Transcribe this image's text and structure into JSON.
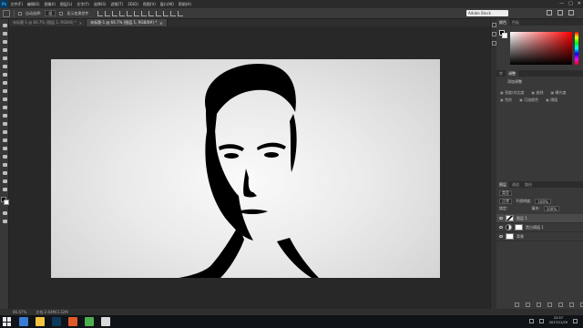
{
  "menubar": {
    "logo": "Ps",
    "items": [
      "文件(F)",
      "编辑(E)",
      "图像(I)",
      "图层(L)",
      "文字(Y)",
      "选择(S)",
      "滤镜(T)",
      "3D(D)",
      "视图(V)",
      "窗口(W)",
      "帮助(H)"
    ],
    "controls": [
      "—",
      "□",
      "✕"
    ]
  },
  "options": {
    "auto_select_label": "自动选择:",
    "auto_select_value": "组",
    "transform_label": "显示变换控件",
    "search_placeholder": "Adobe Stock"
  },
  "tabs": [
    {
      "title": "未标题-1 @ 66.7% (图层 1, RGB/8) *",
      "close": "×"
    },
    {
      "title": "未标题-1 @ 66.7% (图层 1, RGB/8#) *",
      "close": "×"
    }
  ],
  "status": {
    "zoom": "66.67%",
    "doc": "文档:2.64M/3.32M"
  },
  "panels": {
    "color_tabs": [
      "颜色",
      "色板"
    ],
    "adjustment_tabs": [
      "库",
      "调整"
    ],
    "adjust_title": "添加调整",
    "adjust_row1": [
      "亮度/对比度",
      "曲线",
      "曝光度"
    ],
    "adjust_row2": [
      "色阶",
      "可选颜色",
      "阈值"
    ],
    "layers_tabs": [
      "图层",
      "通道",
      "路径"
    ],
    "kind_label": "类型",
    "blend_mode": "正常",
    "opacity_label": "不透明度:",
    "opacity_value": "100%",
    "lock_label": "锁定:",
    "fill_label": "填充:",
    "fill_value": "100%",
    "layers": [
      {
        "name": "图层 1",
        "selected": true
      },
      {
        "name": "黑白阈值 1",
        "selected": false
      },
      {
        "name": "背景",
        "selected": false
      }
    ]
  },
  "taskbar": {
    "clock_time": "22:57",
    "clock_date": "2017/11/29",
    "app_colors": [
      "#3a7bd5",
      "#f5c542",
      "#0d3a5c",
      "#e05a2b",
      "#4caf50",
      "#d9d9d9"
    ]
  }
}
